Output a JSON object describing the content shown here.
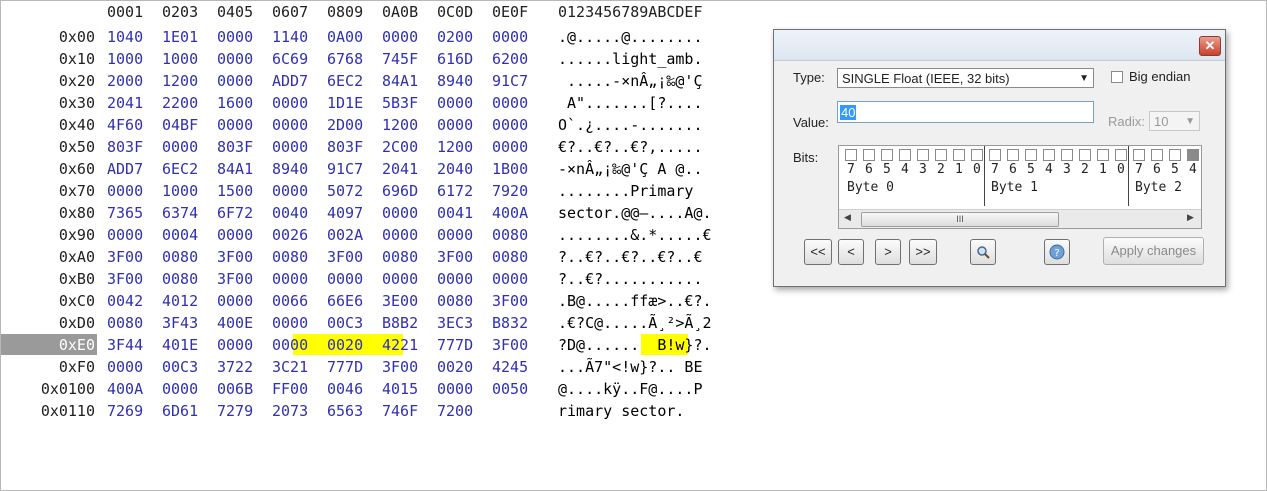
{
  "hex": {
    "columns": [
      "0001",
      "0203",
      "0405",
      "0607",
      "0809",
      "0A0B",
      "0C0D",
      "0E0F"
    ],
    "ascii_header": "0123456789ABCDEF",
    "rows": [
      {
        "offset": "0x00",
        "words": [
          "1040",
          "1E01",
          "0000",
          "1140",
          "0A00",
          "0000",
          "0200",
          "0000"
        ],
        "ascii": ".@.....@........"
      },
      {
        "offset": "0x10",
        "words": [
          "1000",
          "1000",
          "0000",
          "6C69",
          "6768",
          "745F",
          "616D",
          "6200"
        ],
        "ascii": "......light_amb."
      },
      {
        "offset": "0x20",
        "words": [
          "2000",
          "1200",
          "0000",
          "ADD7",
          "6EC2",
          "84A1",
          "8940",
          "91C7"
        ],
        "ascii": " .....-×nÂ„¡‰@'Ç"
      },
      {
        "offset": "0x30",
        "words": [
          "2041",
          "2200",
          "1600",
          "0000",
          "1D1E",
          "5B3F",
          "0000",
          "0000"
        ],
        "ascii": " A\".......[?...."
      },
      {
        "offset": "0x40",
        "words": [
          "4F60",
          "04BF",
          "0000",
          "0000",
          "2D00",
          "1200",
          "0000",
          "0000"
        ],
        "ascii": "O`.¿....-......."
      },
      {
        "offset": "0x50",
        "words": [
          "803F",
          "0000",
          "803F",
          "0000",
          "803F",
          "2C00",
          "1200",
          "0000"
        ],
        "ascii": "€?..€?..€?,....."
      },
      {
        "offset": "0x60",
        "words": [
          "ADD7",
          "6EC2",
          "84A1",
          "8940",
          "91C7",
          "2041",
          "2040",
          "1B00"
        ],
        "ascii": "-×nÂ„¡‰@'Ç A @.."
      },
      {
        "offset": "0x70",
        "words": [
          "0000",
          "1000",
          "1500",
          "0000",
          "5072",
          "696D",
          "6172",
          "7920"
        ],
        "ascii": "........Primary "
      },
      {
        "offset": "0x80",
        "words": [
          "7365",
          "6374",
          "6F72",
          "0040",
          "4097",
          "0000",
          "0041",
          "400A"
        ],
        "ascii": "sector.@@—....A@."
      },
      {
        "offset": "0x90",
        "words": [
          "0000",
          "0004",
          "0000",
          "0026",
          "002A",
          "0000",
          "0000",
          "0080"
        ],
        "ascii": "........&.*.....€"
      },
      {
        "offset": "0xA0",
        "words": [
          "3F00",
          "0080",
          "3F00",
          "0080",
          "3F00",
          "0080",
          "3F00",
          "0080"
        ],
        "ascii": "?..€?..€?..€?..€"
      },
      {
        "offset": "0xB0",
        "words": [
          "3F00",
          "0080",
          "3F00",
          "0000",
          "0000",
          "0000",
          "0000",
          "0000"
        ],
        "ascii": "?..€?..........."
      },
      {
        "offset": "0xC0",
        "words": [
          "0042",
          "4012",
          "0000",
          "0066",
          "66E6",
          "3E00",
          "0080",
          "3F00"
        ],
        "ascii": ".B@.....ffæ>..€?."
      },
      {
        "offset": "0xD0",
        "words": [
          "0080",
          "3F43",
          "400E",
          "0000",
          "00C3",
          "B8B2",
          "3EC3",
          "B832"
        ],
        "ascii": ".€?C@.....Ã¸²>Ã¸2"
      },
      {
        "offset": "0xE0",
        "words": [
          "3F44",
          "401E",
          "0000",
          "0000",
          "0020",
          "4221",
          "777D",
          "3F00"
        ],
        "ascii": "?D@......  B!w}?."
      },
      {
        "offset": "0xF0",
        "words": [
          "0000",
          "00C3",
          "3722",
          "3C21",
          "777D",
          "3F00",
          "0020",
          "4245"
        ],
        "ascii": "...Ã7\"<!w}?.. BE"
      },
      {
        "offset": "0x0100",
        "words": [
          "400A",
          "0000",
          "006B",
          "FF00",
          "0046",
          "4015",
          "0000",
          "0050"
        ],
        "ascii": "@....kÿ..F@....P"
      },
      {
        "offset": "0x0110",
        "words": [
          "7269",
          "6D61",
          "7279",
          "2073",
          "6563",
          "746F",
          "7200",
          ""
        ],
        "ascii": "rimary sector."
      }
    ]
  },
  "dialog": {
    "close_glyph": "✕",
    "type_label": "Type:",
    "type_value": "SINGLE Float (IEEE, 32 bits)",
    "big_endian_label": "Big endian",
    "value_label": "Value:",
    "value": "40",
    "radix_label": "Radix:",
    "radix_value": "10",
    "bits_label": "Bits:",
    "byte_labels": [
      "Byte 0",
      "Byte 1",
      "Byte 2"
    ],
    "bit_numbers": [
      "7",
      "6",
      "5",
      "4",
      "3",
      "2",
      "1",
      "0"
    ],
    "scroll_thumb": "III",
    "nav_first": "<<",
    "nav_prev": "<",
    "nav_next": ">",
    "nav_last": ">>",
    "apply_label": "Apply changes",
    "search_icon": "magnifier-icon",
    "help_icon": "help-icon"
  }
}
